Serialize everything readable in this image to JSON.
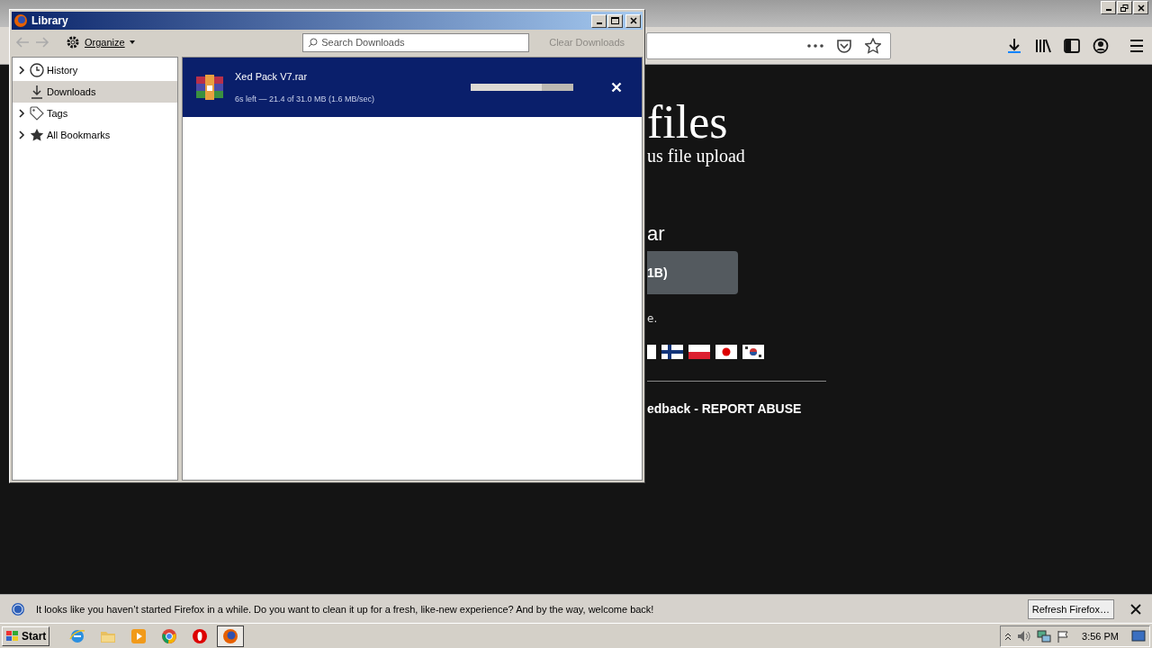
{
  "browser": {
    "page": {
      "title_fragment": "files",
      "subtitle_fragment": "us file upload",
      "filename_fragment": "ar",
      "button_fragment": "1B)",
      "note_fragment": "e.",
      "footer_fragment": "edback - REPORT ABUSE"
    }
  },
  "library": {
    "title": "Library",
    "organize": "Organize",
    "search": {
      "placeholder": "Search Downloads"
    },
    "clear": {
      "label": "Clear Downloads",
      "disabled": true
    },
    "sidebar": [
      {
        "label": "History",
        "kind": "history",
        "expandable": true,
        "selected": false
      },
      {
        "label": "Downloads",
        "kind": "downloads",
        "expandable": false,
        "selected": true
      },
      {
        "label": "Tags",
        "kind": "tags",
        "expandable": true,
        "selected": false
      },
      {
        "label": "All Bookmarks",
        "kind": "bookmarks",
        "expandable": true,
        "selected": false
      }
    ],
    "downloads": [
      {
        "name": "Xed Pack V7.rar",
        "status": "6s left — 21.4 of 31.0 MB (1.6 MB/sec)",
        "level": 0.69,
        "selected": true
      }
    ]
  },
  "notification": {
    "text": "It looks like you haven’t started Firefox in a while. Do you want to clean it up for a fresh, like-new experience? And by the way, welcome back!",
    "button": "Refresh Firefox…"
  },
  "taskbar": {
    "start": "Start",
    "apps": [
      {
        "kind": "ie",
        "selected": false
      },
      {
        "kind": "folder",
        "selected": false
      },
      {
        "kind": "media",
        "selected": false
      },
      {
        "kind": "chrome",
        "selected": false
      },
      {
        "kind": "opera",
        "selected": false
      },
      {
        "kind": "firefox",
        "selected": true
      }
    ],
    "clock": "3:56 PM"
  }
}
